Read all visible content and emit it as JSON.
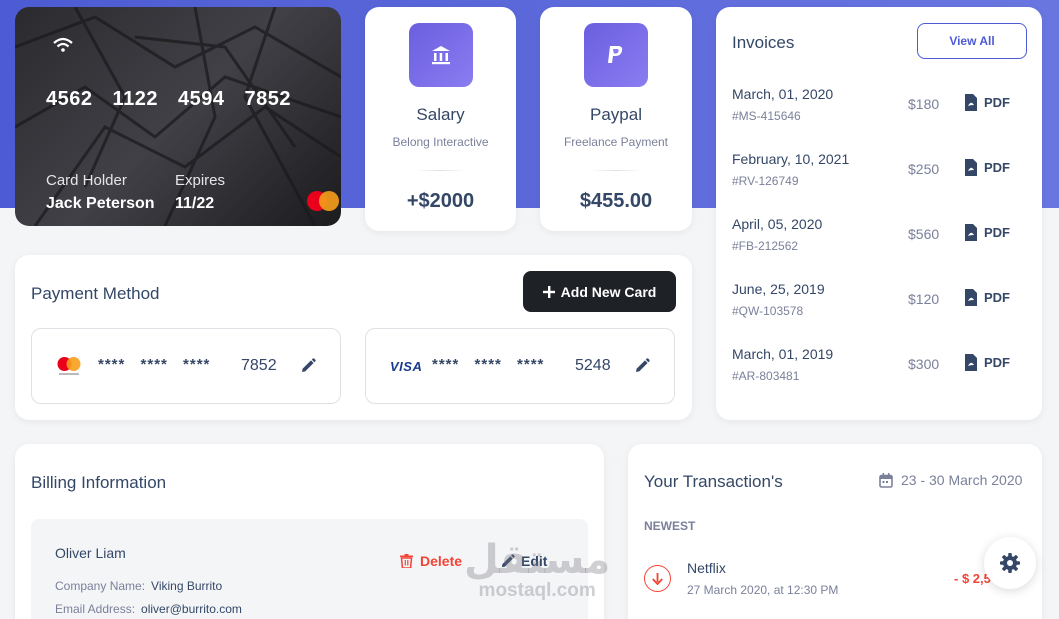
{
  "credit_card": {
    "number": "4562 1122 4594 7852",
    "holder_label": "Card Holder",
    "holder_name": "Jack Peterson",
    "expires_label": "Expires",
    "expires_value": "11/22"
  },
  "stats": [
    {
      "icon": "bank-icon",
      "title": "Salary",
      "subtitle": "Belong Interactive",
      "value": "+$2000"
    },
    {
      "icon": "paypal-icon",
      "title": "Paypal",
      "subtitle": "Freelance Payment",
      "value": "$455.00"
    }
  ],
  "payment_method": {
    "title": "Payment Method",
    "add_button": "Add New Card",
    "cards": [
      {
        "brand": "mastercard",
        "mask": "**** **** ****",
        "last4": "7852"
      },
      {
        "brand": "visa",
        "brand_text": "VISA",
        "mask": "**** **** ****",
        "last4": "5248"
      }
    ]
  },
  "invoices": {
    "title": "Invoices",
    "view_all": "View All",
    "pdf_label": "PDF",
    "items": [
      {
        "date": "March, 01, 2020",
        "id": "#MS-415646",
        "amount": "$180"
      },
      {
        "date": "February, 10, 2021",
        "id": "#RV-126749",
        "amount": "$250"
      },
      {
        "date": "April, 05, 2020",
        "id": "#FB-212562",
        "amount": "$560"
      },
      {
        "date": "June, 25, 2019",
        "id": "#QW-103578",
        "amount": "$120"
      },
      {
        "date": "March, 01, 2019",
        "id": "#AR-803481",
        "amount": "$300"
      }
    ]
  },
  "billing": {
    "title": "Billing Information",
    "name": "Oliver Liam",
    "delete_label": "Delete",
    "edit_label": "Edit",
    "company_label": "Company Name:",
    "company_value": "Viking Burrito",
    "email_label": "Email Address:",
    "email_value": "oliver@burrito.com"
  },
  "transactions": {
    "title": "Your Transaction's",
    "date_range": "23 - 30 March 2020",
    "newest_label": "NEWEST",
    "items": [
      {
        "name": "Netflix",
        "datetime": "27 March 2020, at 12:30 PM",
        "amount": "- $ 2,5"
      }
    ]
  },
  "watermark": {
    "arabic": "مستقل",
    "latin": "mostaql.com"
  },
  "colors": {
    "accent": "#4d5bd4",
    "danger": "#f44335",
    "dark_button": "#1e2125",
    "icon_gradient": "#7b6ee8"
  }
}
